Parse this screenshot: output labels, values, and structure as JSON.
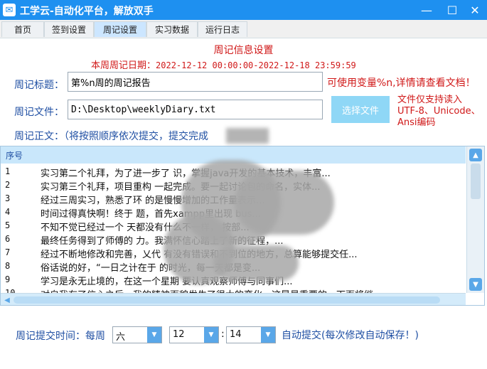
{
  "window": {
    "title": "工学云-自动化平台，解放双手",
    "icon_glyph": "✉",
    "controls": {
      "minimize": "—",
      "maximize": "☐",
      "close": "✕"
    }
  },
  "tabs": [
    {
      "label": "首页"
    },
    {
      "label": "签到设置"
    },
    {
      "label": "周记设置",
      "active": true
    },
    {
      "label": "实习数据"
    },
    {
      "label": "运行日志"
    }
  ],
  "settings": {
    "section_title": "周记信息设置",
    "week_date_label": "本周周记日期：",
    "week_date_value": "2022-12-12 00:00:00-2022-12-18 23:59:59",
    "title_label": "周记标题：",
    "title_value": "第%n周的周记报告",
    "title_hint": "可使用变量%n,详情请查看文档！",
    "file_label": "周记文件：",
    "file_value": "D:\\Desktop\\weeklyDiary.txt",
    "select_file_button": "选择文件",
    "file_note_lines": [
      "文件仅支持读入",
      "UTF-8、Unicode、",
      "Ansi编码"
    ],
    "body_label": "周记正文：（将按照顺序依次提交，提交完成"
  },
  "table": {
    "header": "序号",
    "rows": [
      {
        "num": "1",
        "text": "实习第二个礼拜，为了进一步了                识，掌握java开发的基本技术，丰富..."
      },
      {
        "num": "2",
        "text": " 实习第三个礼拜，项目重构                   一起完成。要一起讨论包的命名，实体..."
      },
      {
        "num": "3",
        "text": "经过三周实习，熟悉了环                      的是慢慢增加的工作量表示..."
      },
      {
        "num": "4",
        "text": "时间过得真快啊！终于                        题，首先xampp里出现 bus..."
      },
      {
        "num": "5",
        "text": " 不知不觉已经过一个                        天都没有什么不一样， 按部..."
      },
      {
        "num": "6",
        "text": "最终任务得到了师傅的                        力。我满怀信心踏上了新的征程，..."
      },
      {
        "num": "7",
        "text": "经过不断地修改和完善，乂代              有没有错误和不到位的地方，总算能够提交任..."
      },
      {
        "num": "8",
        "text": "俗话说的好，“一日之计在于              的时光，每一天都是变..."
      },
      {
        "num": "9",
        "text": "学习是永无止境的，在这一个星期              要认真观察师傅与同事们..."
      },
      {
        "num": "10",
        "text": "对自我有了信心之后，我的精神面貌发生了很大的变化，这是最重要的，下面将继..."
      }
    ],
    "scroll": {
      "up": "▲",
      "down": "▼",
      "left": "◀"
    }
  },
  "submit": {
    "label": "周记提交时间：每周",
    "day": "六",
    "hour": "12",
    "colon": ":",
    "minute": "14",
    "dropdown_glyph": "▼",
    "auto_note": "自动提交(每次修改自动保存！)"
  },
  "colors": {
    "title_bar": "#1e90f0",
    "accent_blue": "#5aa7e8",
    "label_blue": "#1f4fa3",
    "red_text": "#d01818",
    "table_header": "#c9e7fb"
  }
}
